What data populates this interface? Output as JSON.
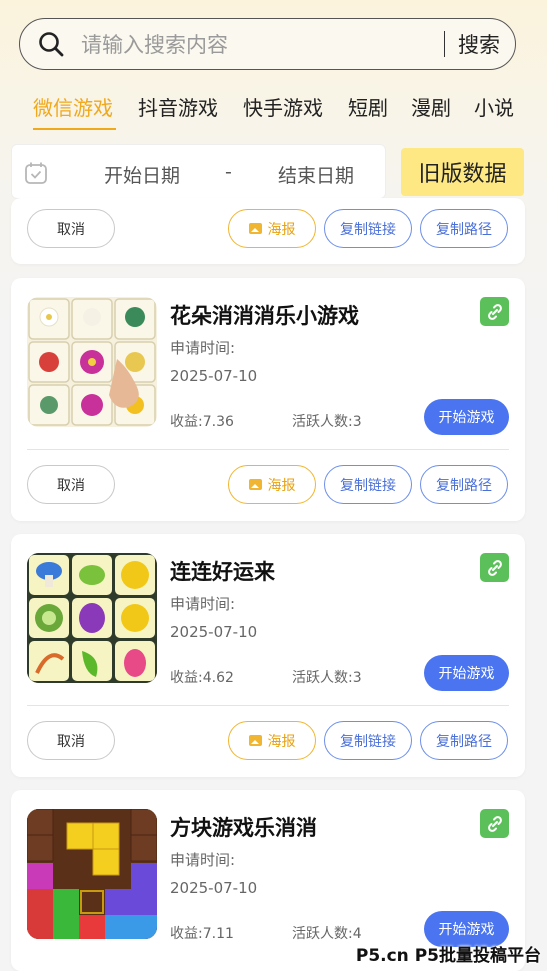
{
  "search": {
    "placeholder": "请输入搜索内容",
    "button_label": "搜索"
  },
  "tabs": [
    {
      "label": "微信游戏",
      "active": true
    },
    {
      "label": "抖音游戏",
      "active": false
    },
    {
      "label": "快手游戏",
      "active": false
    },
    {
      "label": "短剧",
      "active": false
    },
    {
      "label": "漫剧",
      "active": false
    },
    {
      "label": "小说",
      "active": false
    }
  ],
  "date_filter": {
    "start_placeholder": "开始日期",
    "separator": "-",
    "end_placeholder": "结束日期"
  },
  "old_data_button": "旧版数据",
  "actions": {
    "cancel": "取消",
    "poster": "海报",
    "copy_link": "复制链接",
    "copy_path": "复制路径"
  },
  "games": [
    {
      "title": "花朵消消消乐小游戏",
      "apply_label": "申请时间:",
      "apply_date": "2025-07-10",
      "income": "收益:7.36",
      "active_users": "活跃人数:3",
      "play_label": "开始游戏"
    },
    {
      "title": "连连好运来",
      "apply_label": "申请时间:",
      "apply_date": "2025-07-10",
      "income": "收益:4.62",
      "active_users": "活跃人数:3",
      "play_label": "开始游戏"
    },
    {
      "title": "方块游戏乐消消",
      "apply_label": "申请时间:",
      "apply_date": "2025-07-10",
      "income": "收益:7.11",
      "active_users": "活跃人数:4",
      "play_label": "开始游戏"
    }
  ],
  "watermark": "P5.cn P5批量投稿平台",
  "colors": {
    "accent": "#f0a91c",
    "primary_button": "#4a74f0",
    "link_icon": "#5cc05a",
    "old_data_bg": "#fde884"
  }
}
